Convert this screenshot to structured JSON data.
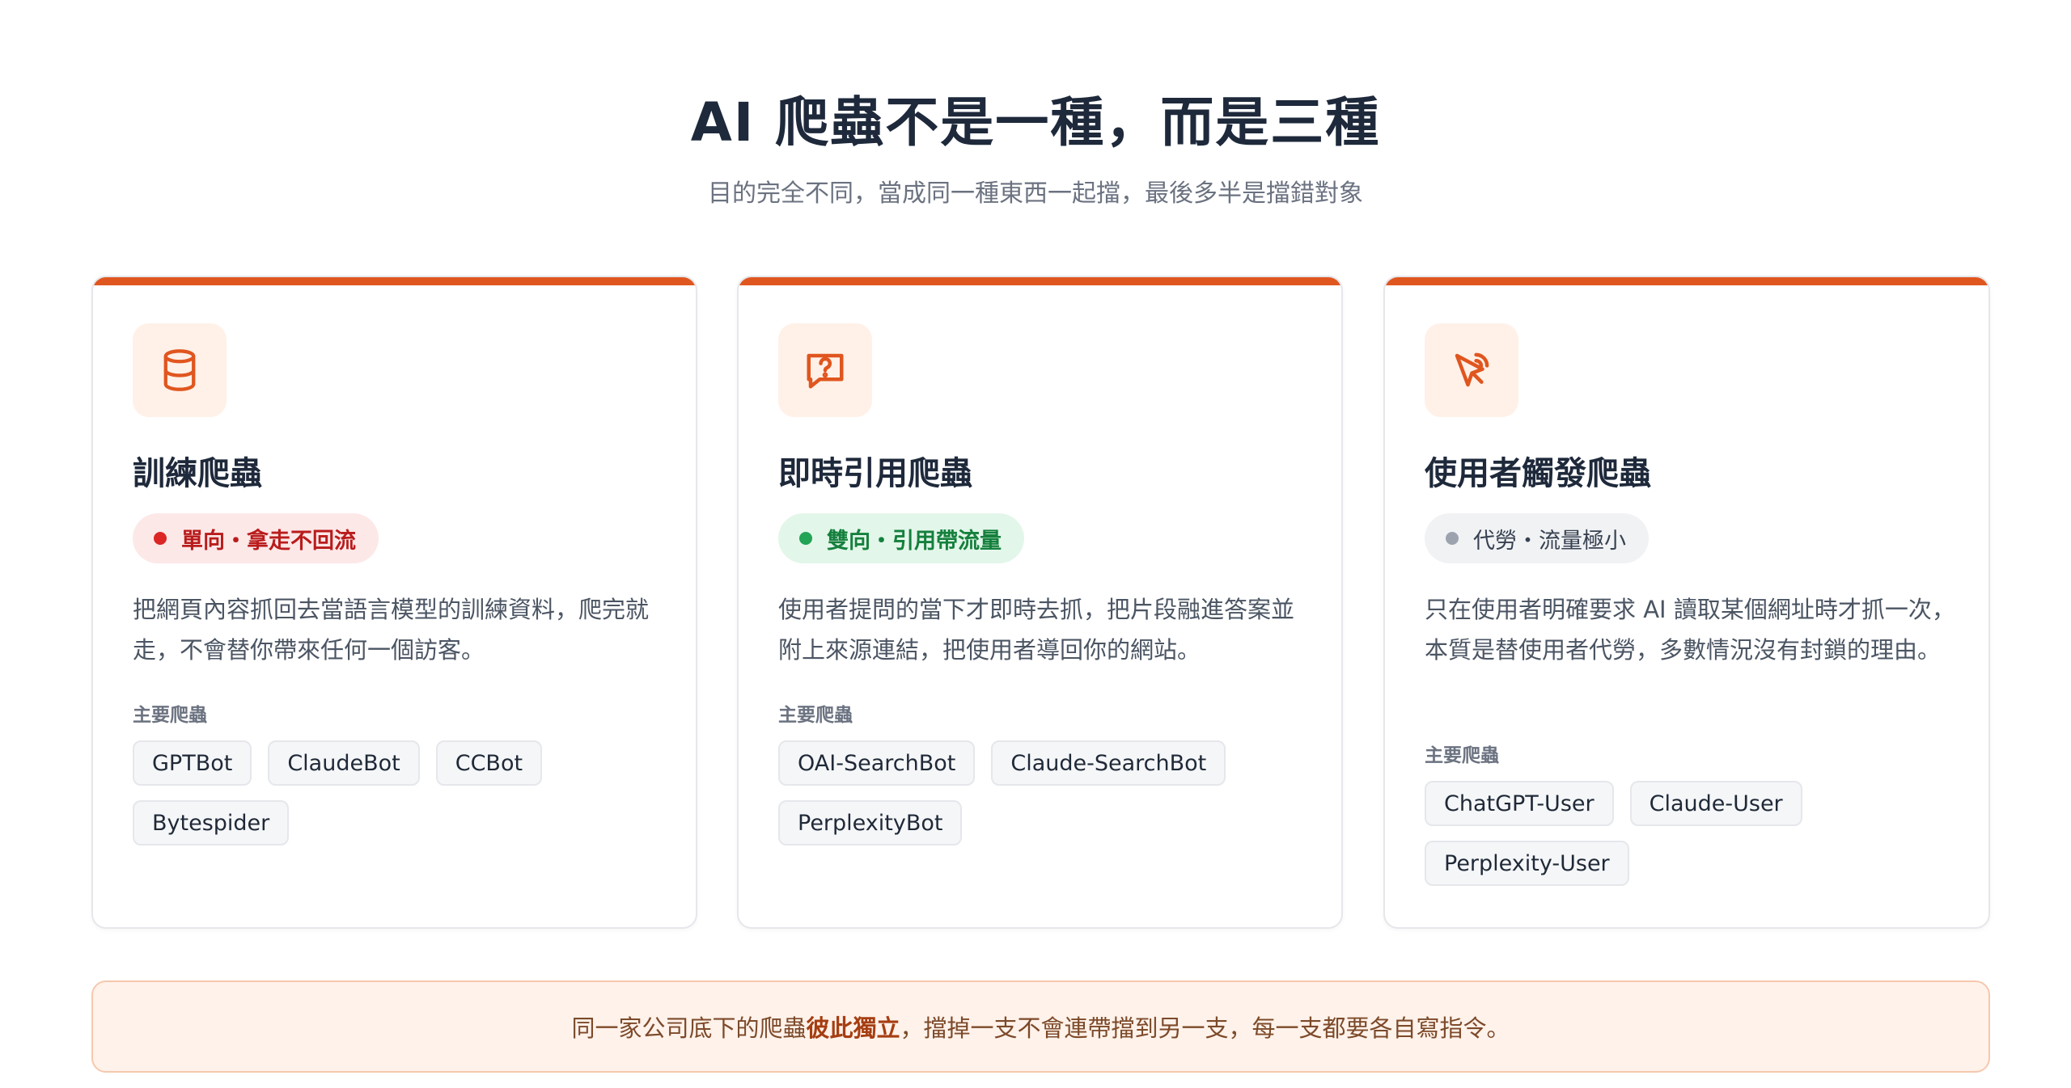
{
  "header": {
    "title": "AI 爬蟲不是一種，而是三種",
    "subtitle": "目的完全不同，當成同一種東西一起擋，最後多半是擋錯對象"
  },
  "colors": {
    "accent": "#e0561f",
    "icon_bg": "#fff1e8",
    "badge_red": "#dc2626",
    "badge_green": "#22a355",
    "badge_gray": "#9ca3af"
  },
  "cards": [
    {
      "icon": "database-icon",
      "title": "訓練爬蟲",
      "badge": "單向・拿走不回流",
      "desc": "把網頁內容抓回去當語言模型的訓練資料，爬完就走，不會替你帶來任何一個訪客。",
      "section_label": "主要爬蟲",
      "bots": [
        "GPTBot",
        "ClaudeBot",
        "CCBot",
        "Bytespider"
      ]
    },
    {
      "icon": "message-question-icon",
      "title": "即時引用爬蟲",
      "badge": "雙向・引用帶流量",
      "desc": "使用者提問的當下才即時去抓，把片段融進答案並附上來源連結，把使用者導回你的網站。",
      "section_label": "主要爬蟲",
      "bots": [
        "OAI-SearchBot",
        "Claude-SearchBot",
        "PerplexityBot"
      ]
    },
    {
      "icon": "pointer-click-icon",
      "title": "使用者觸發爬蟲",
      "badge": "代勞・流量極小",
      "desc": "只在使用者明確要求 AI 讀取某個網址時才抓一次，本質是替使用者代勞，多數情況沒有封鎖的理由。",
      "section_label": "主要爬蟲",
      "bots": [
        "ChatGPT-User",
        "Claude-User",
        "Perplexity-User"
      ]
    }
  ],
  "note": {
    "prefix": "同一家公司底下的爬蟲",
    "emphasis": "彼此獨立",
    "suffix": "，擋掉一支不會連帶擋到另一支，每一支都要各自寫指令。"
  }
}
